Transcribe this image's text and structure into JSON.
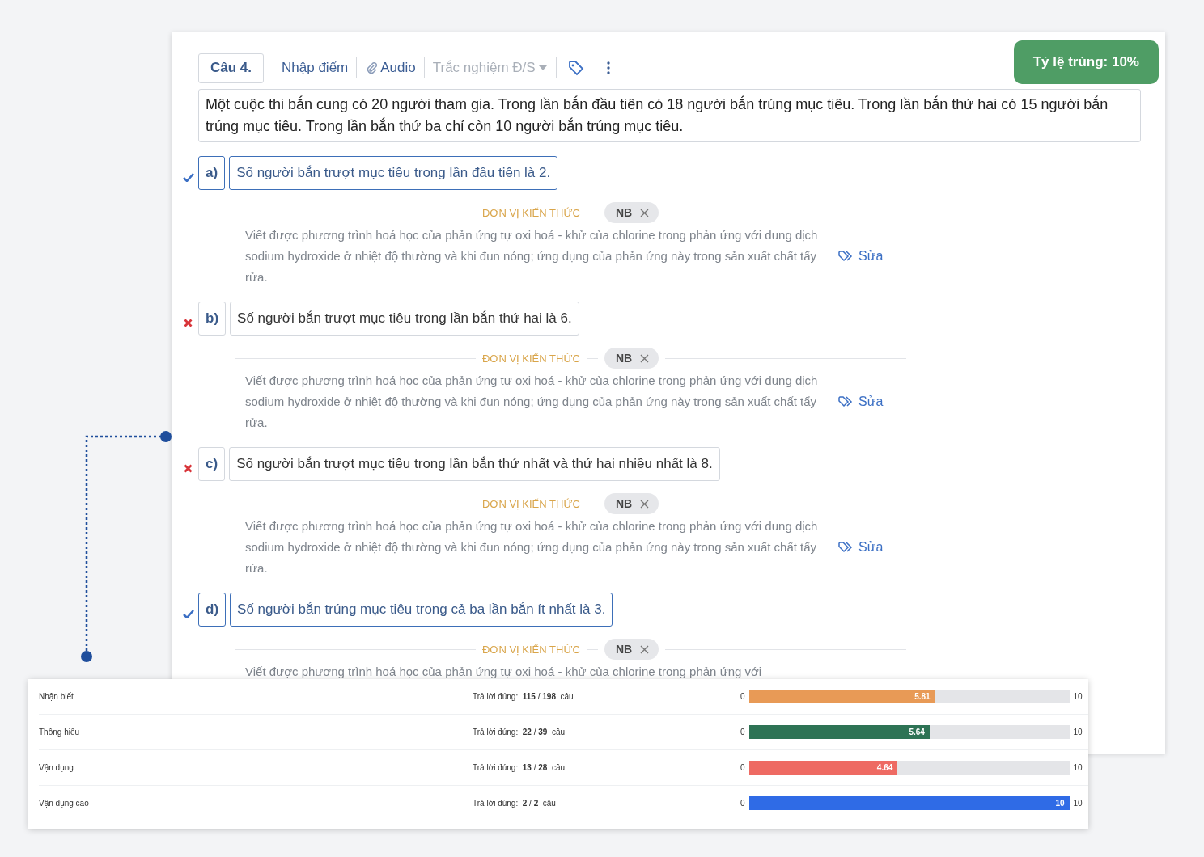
{
  "toolbar": {
    "question_label": "Câu 4.",
    "score_link": "Nhập điểm",
    "audio_link": "Audio",
    "type_dropdown": "Trắc nghiệm Đ/S"
  },
  "match_badge": "Tỷ lệ trùng: 10%",
  "question": "Một cuộc thi bắn cung có 20 người tham gia. Trong lần bắn đầu tiên có 18 người bắn trúng mục tiêu. Trong lần bắn thứ hai có 15 người bắn trúng mục tiêu. Trong lần bắn thứ ba chỉ còn 10 người bắn trúng mục tiêu.",
  "statements": [
    {
      "label": "a)",
      "text": "Số người bắn trượt mục tiêu trong lần đầu tiên là 2.",
      "correct": true,
      "section_title": "ĐƠN VỊ KIẾN THỨC",
      "level_chip": "NB",
      "description": "Viết được phương trình hoá học của phản ứng tự oxi hoá - khử của chlorine trong phản ứng với dung dịch sodium hydroxide ở nhiệt độ thường và khi đun nóng; ứng dụng của phản ứng này trong sản xuất chất tẩy rửa.",
      "edit_link": "Sửa"
    },
    {
      "label": "b)",
      "text": "Số người bắn trượt mục tiêu trong lần bắn thứ hai là 6.",
      "correct": false,
      "section_title": "ĐƠN VỊ KIẾN THỨC",
      "level_chip": "NB",
      "description": "Viết được phương trình hoá học của phản ứng tự oxi hoá - khử của chlorine trong phản ứng với dung dịch sodium hydroxide ở nhiệt độ thường và khi đun nóng; ứng dụng của phản ứng này trong sản xuất chất tẩy rửa.",
      "edit_link": "Sửa"
    },
    {
      "label": "c)",
      "text": "Số người bắn trượt mục tiêu trong lần bắn thứ nhất và thứ hai nhiều nhất là 8.",
      "correct": false,
      "section_title": "ĐƠN VỊ KIẾN THỨC",
      "level_chip": "NB",
      "description": "Viết được phương trình hoá học của phản ứng tự oxi hoá - khử của chlorine trong phản ứng với dung dịch sodium hydroxide ở nhiệt độ thường và khi đun nóng; ứng dụng của phản ứng này trong sản xuất chất tẩy rửa.",
      "edit_link": "Sửa"
    },
    {
      "label": "d)",
      "text": "Số người bắn trúng mục tiêu trong cả ba lần bắn ít nhất là 3.",
      "correct": true,
      "section_title": "ĐƠN VỊ KIẾN THỨC",
      "level_chip": "NB",
      "description": "Viết được phương trình hoá học của phản ứng tự oxi hoá - khử của chlorine trong phản ứng với"
    }
  ],
  "stats": [
    {
      "name": "Nhận biết",
      "answered": "Trả lời đúng:  **115** / **198**  câu",
      "min": "0",
      "score": "5.81",
      "max": "10",
      "level": 0.581,
      "color": "#e89a56"
    },
    {
      "name": "Thông hiểu",
      "answered": "Trả lời đúng:  **22** / **39**  câu",
      "min": "0",
      "score": "5.64",
      "max": "10",
      "level": 0.564,
      "color": "#2e7355"
    },
    {
      "name": "Vận dụng",
      "answered": "Trả lời đúng:  **13** / **28**  câu",
      "min": "0",
      "score": "4.64",
      "max": "10",
      "level": 0.464,
      "color": "#ee6a63"
    },
    {
      "name": "Vận dụng cao",
      "answered": "Trả lời đúng:  **2** / **2**  câu",
      "min": "0",
      "score": "10",
      "max": "10",
      "level": 1,
      "color": "#2f6be6"
    }
  ]
}
